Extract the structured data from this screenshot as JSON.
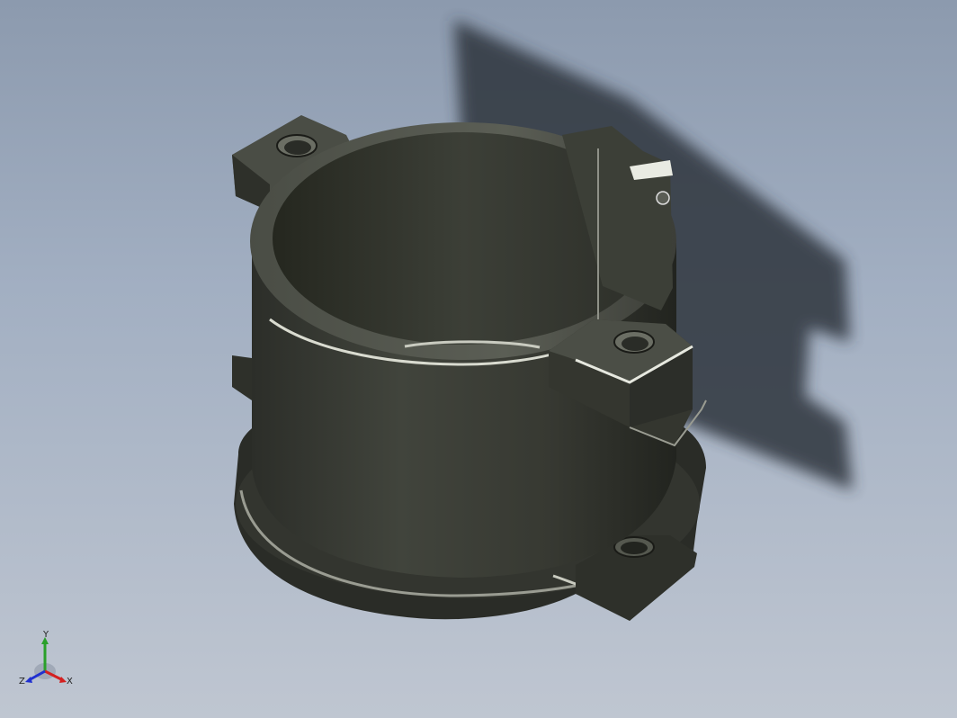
{
  "viewport": {
    "background_top": "#8c9aae",
    "background_bottom": "#bfc6d1"
  },
  "model": {
    "color": "#3a3c36",
    "shadow_color": "#2f353d"
  },
  "triad": {
    "x_label": "X",
    "y_label": "Y",
    "z_label": "Z",
    "x_color": "#d42020",
    "y_color": "#2aa02a",
    "z_color": "#2030d0"
  }
}
